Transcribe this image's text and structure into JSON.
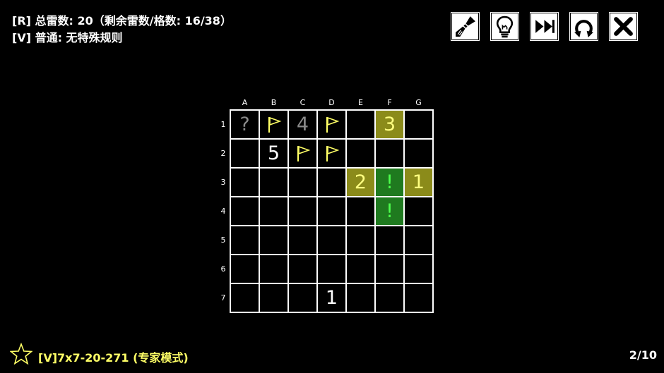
{
  "info": {
    "line1": "[R] 总雷数: 20（剩余雷数/格数: 16/38）",
    "line2": "[V] 普通: 无特殊规则"
  },
  "toolbar": [
    {
      "name": "brush-button",
      "icon": "brush-icon"
    },
    {
      "name": "hint-button",
      "icon": "lightbulb-icon"
    },
    {
      "name": "skip-button",
      "icon": "fast-forward-icon"
    },
    {
      "name": "restart-button",
      "icon": "restart-icon"
    },
    {
      "name": "close-button",
      "icon": "close-icon"
    }
  ],
  "board": {
    "columns": [
      "A",
      "B",
      "C",
      "D",
      "E",
      "F",
      "G"
    ],
    "rows": [
      "1",
      "2",
      "3",
      "4",
      "5",
      "6",
      "7"
    ],
    "cells": [
      [
        {
          "t": "text",
          "v": "?",
          "s": "gray"
        },
        {
          "t": "flag"
        },
        {
          "t": "text",
          "v": "4",
          "s": "gray"
        },
        {
          "t": "flag"
        },
        {
          "t": "empty"
        },
        {
          "t": "text",
          "v": "3",
          "s": "hl-y"
        },
        {
          "t": "empty"
        }
      ],
      [
        {
          "t": "empty"
        },
        {
          "t": "text",
          "v": "5"
        },
        {
          "t": "flag"
        },
        {
          "t": "flag"
        },
        {
          "t": "empty"
        },
        {
          "t": "empty"
        },
        {
          "t": "empty"
        }
      ],
      [
        {
          "t": "empty"
        },
        {
          "t": "empty"
        },
        {
          "t": "empty"
        },
        {
          "t": "empty"
        },
        {
          "t": "text",
          "v": "2",
          "s": "hl-y"
        },
        {
          "t": "text",
          "v": "!",
          "s": "hl-g"
        },
        {
          "t": "text",
          "v": "1",
          "s": "hl-y"
        }
      ],
      [
        {
          "t": "empty"
        },
        {
          "t": "empty"
        },
        {
          "t": "empty"
        },
        {
          "t": "empty"
        },
        {
          "t": "empty"
        },
        {
          "t": "text",
          "v": "!",
          "s": "hl-g"
        },
        {
          "t": "empty"
        }
      ],
      [
        {
          "t": "empty"
        },
        {
          "t": "empty"
        },
        {
          "t": "empty"
        },
        {
          "t": "empty"
        },
        {
          "t": "empty"
        },
        {
          "t": "empty"
        },
        {
          "t": "empty"
        }
      ],
      [
        {
          "t": "empty"
        },
        {
          "t": "empty"
        },
        {
          "t": "empty"
        },
        {
          "t": "empty"
        },
        {
          "t": "empty"
        },
        {
          "t": "empty"
        },
        {
          "t": "empty"
        }
      ],
      [
        {
          "t": "empty"
        },
        {
          "t": "empty"
        },
        {
          "t": "empty"
        },
        {
          "t": "text",
          "v": "1"
        },
        {
          "t": "empty"
        },
        {
          "t": "empty"
        },
        {
          "t": "empty"
        }
      ]
    ]
  },
  "footer": {
    "title": "[V]7x7-20-271 (专家模式)",
    "page": "2/10"
  },
  "colors": {
    "flag": "#ffff66",
    "highlight_yellow": "#8b8b1a",
    "highlight_green": "#1f7a1f"
  }
}
